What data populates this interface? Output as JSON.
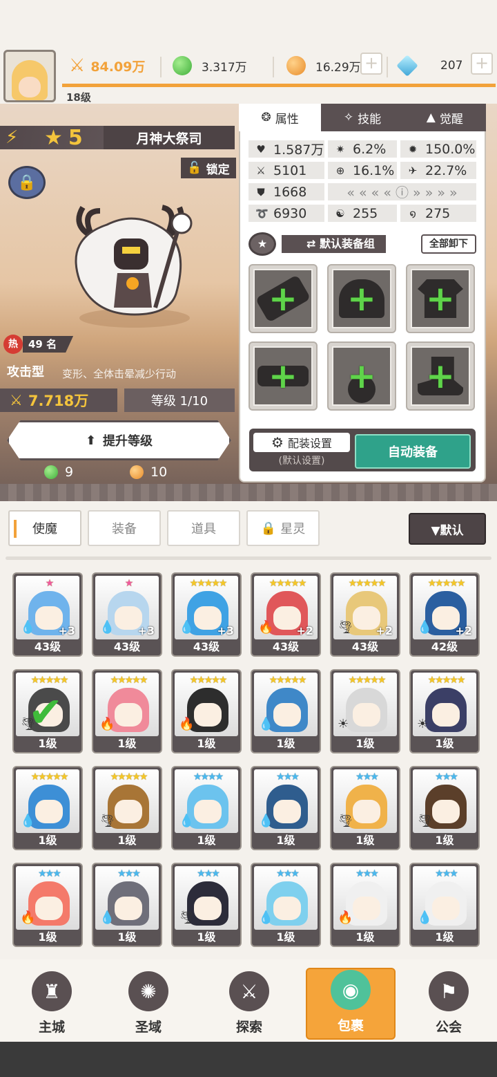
{
  "header": {
    "player_level": "18级",
    "power": "84.09万",
    "green_currency": "3.317万",
    "orange_currency": "16.29万",
    "gems": "207",
    "colors": {
      "power": "#f2a23a",
      "green": "#5ccb52",
      "orange": "#f0a83a",
      "gem": "#5fc3e8"
    }
  },
  "hero": {
    "stars": "5",
    "name": "月神大祭司",
    "lock_label": "锁定",
    "hot_label": "热",
    "rank": "49 名",
    "type": "攻击型",
    "skills": "变形、全体击晕减少行动",
    "power": "7.718万",
    "level": "等级 1/10",
    "upgrade_label": "提升等级",
    "cost_green": "9",
    "cost_orange": "10"
  },
  "panel": {
    "tabs": [
      {
        "label": "属性",
        "icon": "attribute-icon"
      },
      {
        "label": "技能",
        "icon": "skill-icon"
      },
      {
        "label": "觉醒",
        "icon": "awaken-icon"
      }
    ],
    "stats": [
      {
        "icon": "heart-icon",
        "glyph": "♥",
        "value": "1.587万"
      },
      {
        "icon": "crit-icon",
        "glyph": "✷",
        "value": "6.2%"
      },
      {
        "icon": "crit-damage-icon",
        "glyph": "✹",
        "value": "150.0%"
      },
      {
        "icon": "attack-icon",
        "glyph": "⚔",
        "value": "5101"
      },
      {
        "icon": "accuracy-icon",
        "glyph": "⊕",
        "value": "16.1%"
      },
      {
        "icon": "dodge-icon",
        "glyph": "✈",
        "value": "22.7%"
      },
      {
        "icon": "defense-icon",
        "glyph": "⛊",
        "value": "1668"
      },
      {
        "icon": "speed-icon",
        "glyph": "➰",
        "value": "6930"
      },
      {
        "icon": "resist-icon",
        "glyph": "☯",
        "value": "255"
      },
      {
        "icon": "tenacity-icon",
        "glyph": "໑",
        "value": "275"
      }
    ],
    "equip_group_label": "默认装备组",
    "unequip_all": "全部卸下",
    "config_label": "配装设置",
    "config_sub": "(默认设置)",
    "auto_equip": "自动装备"
  },
  "collection": {
    "tabs": [
      "使魔",
      "装备",
      "道具",
      "星灵"
    ],
    "sort_label": "▼默认",
    "cards": [
      {
        "stars": "★",
        "star_color": "pink",
        "element": "💧",
        "plus": "+3",
        "level": "43级",
        "hue": "#6fb3ec"
      },
      {
        "stars": "★",
        "star_color": "pink",
        "element": "💧",
        "plus": "+3",
        "level": "43级",
        "hue": "#b7d6ee"
      },
      {
        "stars": "★★★★★",
        "star_color": "gold",
        "element": "💧",
        "plus": "+3",
        "level": "43级",
        "hue": "#3fa2e4"
      },
      {
        "stars": "★★★★★",
        "star_color": "gold",
        "element": "🔥",
        "plus": "+2",
        "level": "43级",
        "hue": "#e0575a"
      },
      {
        "stars": "★★★★★",
        "star_color": "gold",
        "element": "🌪",
        "plus": "+2",
        "level": "43级",
        "hue": "#e8c87a"
      },
      {
        "stars": "★★★★★",
        "star_color": "gold",
        "element": "💧",
        "plus": "+2",
        "level": "42级",
        "hue": "#2b5fa0"
      },
      {
        "stars": "★★★★★",
        "star_color": "gold",
        "element": "🌪",
        "plus": "",
        "level": "1级",
        "hue": "#4a4a4a"
      },
      {
        "stars": "★★★★★",
        "star_color": "gold",
        "element": "🔥",
        "plus": "",
        "level": "1级",
        "hue": "#f08a9a"
      },
      {
        "stars": "★★★★★",
        "star_color": "gold",
        "element": "🔥",
        "plus": "",
        "level": "1级",
        "hue": "#2d2d2d"
      },
      {
        "stars": "★★★★★",
        "star_color": "gold",
        "element": "💧",
        "plus": "",
        "level": "1级",
        "hue": "#3f88c8"
      },
      {
        "stars": "★★★★★",
        "star_color": "gold",
        "element": "☀",
        "plus": "",
        "level": "1级",
        "hue": "#d8d8d8"
      },
      {
        "stars": "★★★★★",
        "star_color": "gold",
        "element": "☀",
        "plus": "",
        "level": "1级",
        "hue": "#3b3f66"
      },
      {
        "stars": "★★★★★",
        "star_color": "gold",
        "element": "💧",
        "plus": "",
        "level": "1级",
        "hue": "#3d8fd6"
      },
      {
        "stars": "★★★★★",
        "star_color": "gold",
        "element": "🌪",
        "plus": "",
        "level": "1级",
        "hue": "#a87536"
      },
      {
        "stars": "★★★★",
        "star_color": "blue",
        "element": "💧",
        "plus": "",
        "level": "1级",
        "hue": "#6cc3ee"
      },
      {
        "stars": "★★★",
        "star_color": "blue",
        "element": "💧",
        "plus": "",
        "level": "1级",
        "hue": "#2f5d8e"
      },
      {
        "stars": "★★★",
        "star_color": "blue",
        "element": "🌪",
        "plus": "",
        "level": "1级",
        "hue": "#f0b24a"
      },
      {
        "stars": "★★★",
        "star_color": "blue",
        "element": "🌪",
        "plus": "",
        "level": "1级",
        "hue": "#5b3f2a"
      },
      {
        "stars": "★★★",
        "star_color": "blue",
        "element": "🔥",
        "plus": "",
        "level": "1级",
        "hue": "#f47a6a"
      },
      {
        "stars": "★★★",
        "star_color": "blue",
        "element": "💧",
        "plus": "",
        "level": "1级",
        "hue": "#6f6f7a"
      },
      {
        "stars": "★★★",
        "star_color": "blue",
        "element": "🌪",
        "plus": "",
        "level": "1级",
        "hue": "#2c2c3a"
      },
      {
        "stars": "★★★",
        "star_color": "blue",
        "element": "💧",
        "plus": "",
        "level": "1级",
        "hue": "#7fd0ee"
      },
      {
        "stars": "★★★",
        "star_color": "blue",
        "element": "🔥",
        "plus": "",
        "level": "1级",
        "hue": "#f0f0f0"
      },
      {
        "stars": "★★★",
        "star_color": "blue",
        "element": "💧",
        "plus": "",
        "level": "1级",
        "hue": "#f0f0f0"
      }
    ],
    "checked_index": 6
  },
  "nav": [
    {
      "label": "主城",
      "icon": "castle-icon",
      "glyph": "♜"
    },
    {
      "label": "圣域",
      "icon": "portal-icon",
      "glyph": "✺"
    },
    {
      "label": "探索",
      "icon": "sword-icon",
      "glyph": "⚔"
    },
    {
      "label": "包裹",
      "icon": "bag-icon",
      "glyph": "◉"
    },
    {
      "label": "公会",
      "icon": "guild-icon",
      "glyph": "⚑"
    }
  ]
}
